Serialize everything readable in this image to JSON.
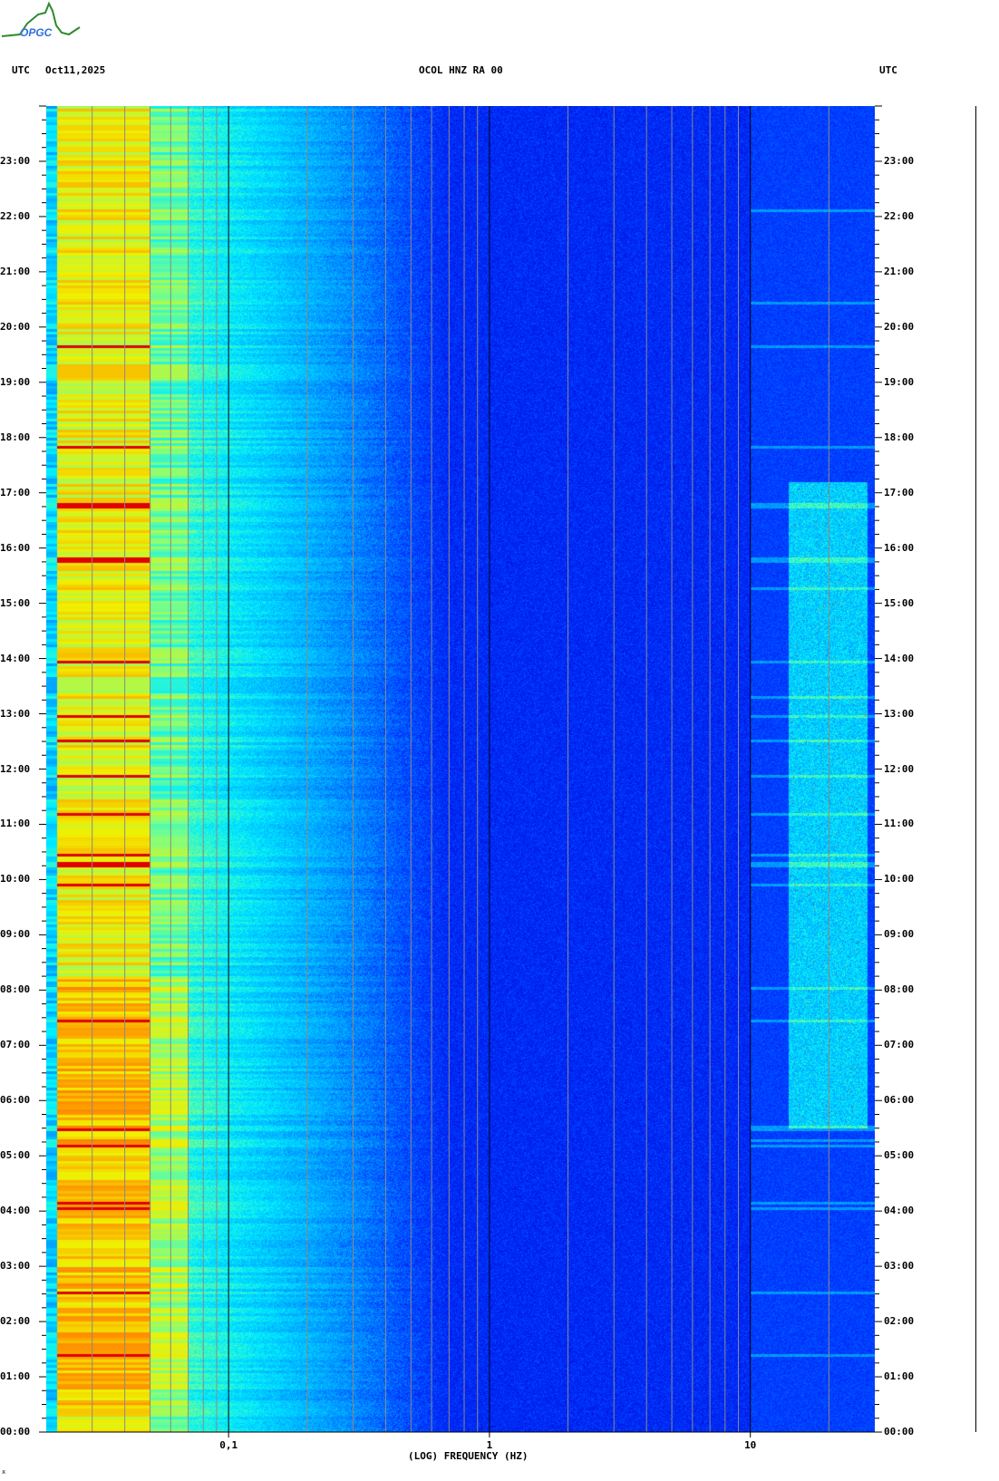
{
  "header": {
    "logo_text": "OPGC",
    "left_label": "UTC",
    "date": "Oct11,2025",
    "station": "OCOL HNZ RA 00",
    "right_label": "UTC"
  },
  "footer_mark": "x",
  "chart_data": {
    "type": "heatmap",
    "title": "OCOL HNZ RA 00",
    "xlabel": "(LOG) FREQUENCY (HZ)",
    "ylabel": "UTC",
    "xscale": "log",
    "xlim": [
      0.02,
      30
    ],
    "ylim": [
      0,
      24
    ],
    "x_ticks": [
      {
        "value": 0.1,
        "label": "0,1"
      },
      {
        "value": 1,
        "label": "1"
      },
      {
        "value": 10,
        "label": "10"
      }
    ],
    "y_ticks": [
      "00:00",
      "01:00",
      "02:00",
      "03:00",
      "04:00",
      "05:00",
      "06:00",
      "07:00",
      "08:00",
      "09:00",
      "10:00",
      "11:00",
      "12:00",
      "13:00",
      "14:00",
      "15:00",
      "16:00",
      "17:00",
      "18:00",
      "19:00",
      "20:00",
      "21:00",
      "22:00",
      "23:00"
    ],
    "colormap": [
      "#0000c8",
      "#0030ff",
      "#00a0ff",
      "#00f0ff",
      "#80ff80",
      "#f0f000",
      "#ff9000",
      "#e00000"
    ],
    "features": {
      "microseism_band_hz": [
        0.022,
        0.07
      ],
      "high_freq_activity_hours": [
        5.5,
        17.2
      ],
      "high_freq_activity_band_hz": [
        14,
        28
      ],
      "strong_low_freq_hours": [
        0.5,
        8.2
      ]
    }
  }
}
